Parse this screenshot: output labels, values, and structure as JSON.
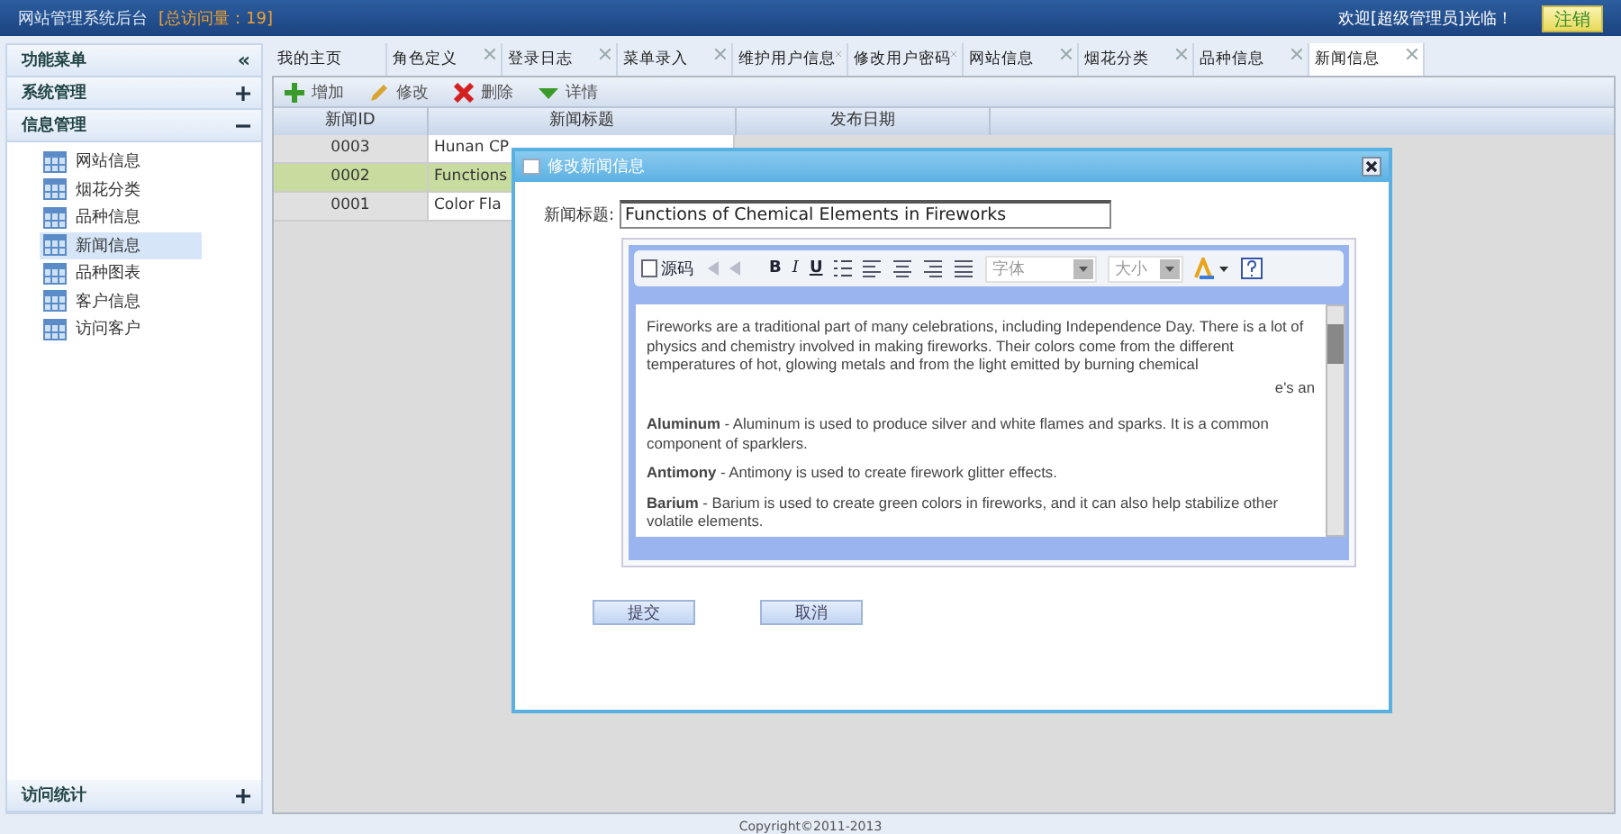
{
  "header": {
    "title": "网站管理系统后台",
    "visits": "[总访问量：19]",
    "welcome": "欢迎[超级管理员]光临！",
    "logout": "注销"
  },
  "sidebar": {
    "title": "功能菜单",
    "collapse": "«",
    "sections": [
      {
        "label": "系统管理",
        "expanded": false
      },
      {
        "label": "信息管理",
        "expanded": true,
        "items": [
          {
            "label": "网站信息",
            "selected": false
          },
          {
            "label": "烟花分类",
            "selected": false
          },
          {
            "label": "品种信息",
            "selected": false
          },
          {
            "label": "新闻信息",
            "selected": true
          },
          {
            "label": "品种图表",
            "selected": false
          },
          {
            "label": "客户信息",
            "selected": false
          },
          {
            "label": "访问客户",
            "selected": false
          }
        ]
      }
    ],
    "bottom": {
      "label": "访问统计",
      "expanded": false
    }
  },
  "tabs": [
    {
      "label": "我的主页",
      "selected": false,
      "closable": false
    },
    {
      "label": "角色定义",
      "selected": false,
      "closable": true
    },
    {
      "label": "登录日志",
      "selected": false,
      "closable": true
    },
    {
      "label": "菜单录入",
      "selected": false,
      "closable": true
    },
    {
      "label": "维护用户信息",
      "selected": false,
      "closable": true
    },
    {
      "label": "修改用户密码",
      "selected": false,
      "closable": true
    },
    {
      "label": "网站信息",
      "selected": false,
      "closable": true
    },
    {
      "label": "烟花分类",
      "selected": false,
      "closable": true
    },
    {
      "label": "品种信息",
      "selected": false,
      "closable": true
    },
    {
      "label": "新闻信息",
      "selected": true,
      "closable": true
    }
  ],
  "toolbar": [
    {
      "kind": "add",
      "label": "增加"
    },
    {
      "kind": "edit",
      "label": "修改"
    },
    {
      "kind": "delete",
      "label": "删除"
    },
    {
      "kind": "details",
      "label": "详情"
    }
  ],
  "table": {
    "columns": [
      "新闻ID",
      "新闻标题",
      "发布日期"
    ],
    "rows": [
      {
        "id": "0003",
        "title": "Hunan CP",
        "selected": false
      },
      {
        "id": "0002",
        "title": "Functions",
        "selected": true
      },
      {
        "id": "0001",
        "title": "Color Fla",
        "selected": false
      }
    ]
  },
  "dialog": {
    "title": "修改新闻信息",
    "field_label": "新闻标题:",
    "field_value": "Functions of Chemical Elements in Fireworks",
    "editor_tools": [
      {
        "kind": "source",
        "label": "源码"
      },
      {
        "kind": "bold",
        "label": "B"
      },
      {
        "kind": "italic",
        "label": "I"
      },
      {
        "kind": "underline",
        "label": "U"
      },
      {
        "kind": "font",
        "label": "字体"
      },
      {
        "kind": "size",
        "label": "大小"
      }
    ],
    "paragraphs": [
      "Fireworks are a traditional part of many celebrations, including Independence Day. There is a lot of physics and chemistry involved in making fireworks. Their colors come from the different temperatures of hot, glowing metals and from the light emitted by burning chemical",
      "**Aluminum** - Aluminum is used to produce silver and white flames and sparks. It is a common component of sparklers.",
      "**Antimony** - Antimony is used to create firework glitter effects.",
      "**Barium** - Barium is used to create green colors in fireworks, and it can also help stabilize other volatile elements."
    ],
    "fragment": "e's an",
    "buttons": [
      "提交",
      "取消"
    ]
  },
  "footer": "Copyright©2011-2013"
}
